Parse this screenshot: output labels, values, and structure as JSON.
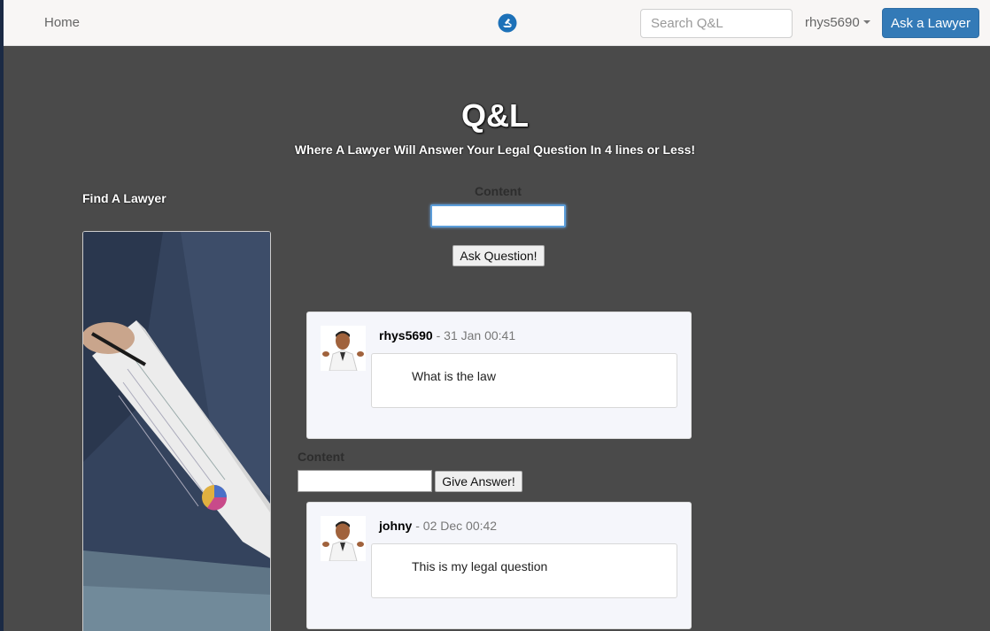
{
  "nav": {
    "home": "Home",
    "search_placeholder": "Search Q&L",
    "user": "rhys5690",
    "ask_button": "Ask a Lawyer"
  },
  "hero": {
    "title": "Q&L",
    "subtitle": "Where A Lawyer Will Answer Your Legal Question In 4 lines or Less!"
  },
  "sidebar": {
    "find_lawyer": "Find A Lawyer"
  },
  "question_form": {
    "label": "Content",
    "value": "",
    "button": "Ask Question!"
  },
  "answer_form": {
    "label": "Content",
    "value": "",
    "button": "Give Answer!"
  },
  "posts": [
    {
      "user": "rhys5690",
      "sep": " - ",
      "time": "31 Jan 00:41",
      "text": "What is the law"
    },
    {
      "user": "johny",
      "sep": " - ",
      "time": "02 Dec 00:42",
      "text": "This is my legal question"
    }
  ],
  "colors": {
    "page_bg": "#4a4a4a",
    "navbar_bg": "#f8f6f5",
    "accent": "#337ab7",
    "card_bg": "#f5f6fb"
  }
}
